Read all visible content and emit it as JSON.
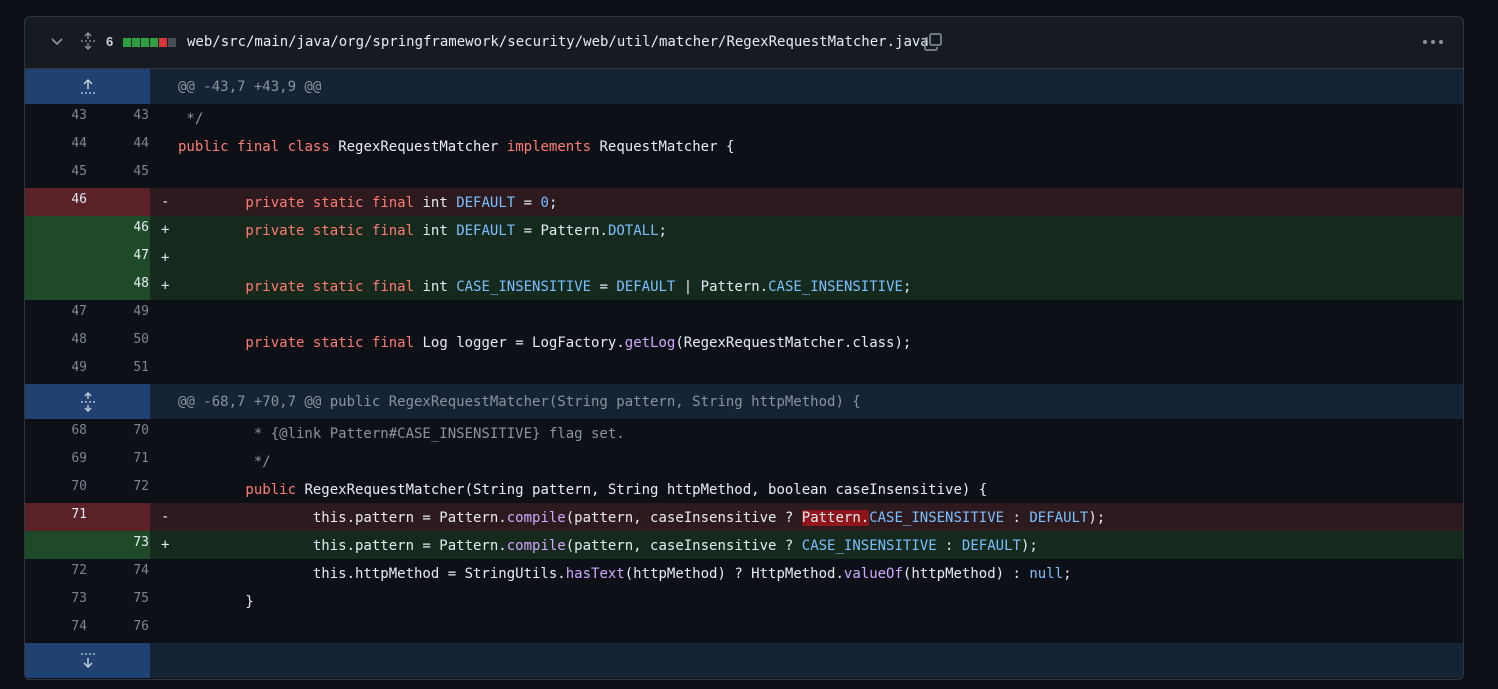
{
  "file_header": {
    "changes_count": "6",
    "diffstat": [
      "add",
      "add",
      "add",
      "add",
      "del",
      "neutral"
    ],
    "path": "web/src/main/java/org/springframework/security/web/util/matcher/RegexRequestMatcher.java"
  },
  "colors": {
    "addition_gutter": "#1e4a2a",
    "addition_bg": "#15291d",
    "deletion_gutter": "#5a2227",
    "deletion_bg": "#2d1a1f",
    "hunk_bg": "#162236",
    "keyword": "#ff7b72",
    "constant": "#79c0ff",
    "function": "#d2a8ff"
  },
  "hunks": {
    "first": "@@ -43,7 +43,9 @@",
    "second": "@@ -68,7 +70,7 @@ public RegexRequestMatcher(String pattern, String httpMethod) {"
  },
  "lines": {
    "l1": {
      "old": "43",
      "new": "43",
      "sign": "",
      "t1": " */"
    },
    "l2": {
      "old": "44",
      "new": "44",
      "sign": "",
      "t1": "public",
      "t2": " ",
      "t3": "final",
      "t4": " ",
      "t5": "class",
      "t6": " RegexRequestMatcher ",
      "t7": "implements",
      "t8": " RequestMatcher {"
    },
    "l3": {
      "old": "45",
      "new": "45",
      "sign": ""
    },
    "l4": {
      "old": "46",
      "new": "",
      "sign": "-",
      "t1": "        private",
      "t2": " ",
      "t3": "static",
      "t4": " ",
      "t5": "final",
      "t6": " int ",
      "t7": "DEFAULT",
      "t8": " = ",
      "t9": "0",
      "t10": ";"
    },
    "l5": {
      "old": "",
      "new": "46",
      "sign": "+",
      "t1": "        private",
      "t2": " ",
      "t3": "static",
      "t4": " ",
      "t5": "final",
      "t6": " int ",
      "t7": "DEFAULT",
      "t8": " = Pattern.",
      "t9": "DOTALL",
      "t10": ";"
    },
    "l6": {
      "old": "",
      "new": "47",
      "sign": "+"
    },
    "l7": {
      "old": "",
      "new": "48",
      "sign": "+",
      "t1": "        private",
      "t2": " ",
      "t3": "static",
      "t4": " ",
      "t5": "final",
      "t6": " int ",
      "t7": "CASE_INSENSITIVE",
      "t8": " = ",
      "t9": "DEFAULT",
      "t10": " | Pattern.",
      "t11": "CASE_INSENSITIVE",
      "t12": ";"
    },
    "l8": {
      "old": "47",
      "new": "49",
      "sign": ""
    },
    "l9": {
      "old": "48",
      "new": "50",
      "sign": "",
      "t1": "        private",
      "t2": " ",
      "t3": "static",
      "t4": " ",
      "t5": "final",
      "t6": " Log logger = LogFactory.",
      "t7": "getLog",
      "t8": "(RegexRequestMatcher.class);"
    },
    "l10": {
      "old": "49",
      "new": "51",
      "sign": ""
    },
    "l11": {
      "old": "68",
      "new": "70",
      "sign": "",
      "t1": "         * {@link Pattern#CASE_INSENSITIVE} flag set."
    },
    "l12": {
      "old": "69",
      "new": "71",
      "sign": "",
      "t1": "         */"
    },
    "l13": {
      "old": "70",
      "new": "72",
      "sign": "",
      "t1": "        public",
      "t2": " RegexRequestMatcher(String pattern, String httpMethod, boolean caseInsensitive) {"
    },
    "l14": {
      "old": "71",
      "new": "",
      "sign": "-",
      "t1": "                this.pattern = Pattern.",
      "t2": "compile",
      "t3": "(pattern, caseInsensitive ? ",
      "t4": "Pattern.",
      "t5": "CASE_INSENSITIVE",
      "t6": " : ",
      "t7": "DEFAULT",
      "t8": ");"
    },
    "l15": {
      "old": "",
      "new": "73",
      "sign": "+",
      "t1": "                this.pattern = Pattern.",
      "t2": "compile",
      "t3": "(pattern, caseInsensitive ? ",
      "t4": "CASE_INSENSITIVE",
      "t5": " : ",
      "t6": "DEFAULT",
      "t7": ");"
    },
    "l16": {
      "old": "72",
      "new": "74",
      "sign": "",
      "t1": "                this.httpMethod = StringUtils.",
      "t2": "hasText",
      "t3": "(httpMethod) ? HttpMethod.",
      "t4": "valueOf",
      "t5": "(httpMethod) : ",
      "t6": "null",
      "t7": ";"
    },
    "l17": {
      "old": "73",
      "new": "75",
      "sign": "",
      "t1": "        }"
    },
    "l18": {
      "old": "74",
      "new": "76",
      "sign": ""
    }
  }
}
